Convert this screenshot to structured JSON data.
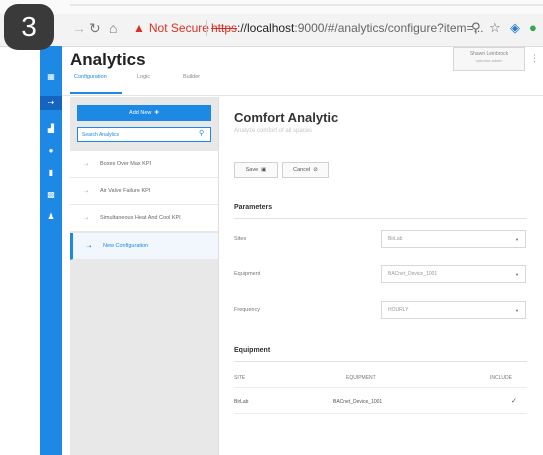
{
  "step": {
    "number": "3"
  },
  "browser": {
    "not_secure_label": "Not Secure",
    "url_scheme": "https",
    "url_host": "://localhost",
    "url_rest": ":9000/#/analytics/configure?item=..."
  },
  "icons": {
    "back": "back-arrow-icon",
    "reload": "reload-icon",
    "home": "home-icon",
    "search": "magnifier-icon",
    "star": "star-icon",
    "extension1": "extension-icon",
    "extension2": "extension-icon"
  },
  "colors": {
    "accent": "#1e88e5",
    "rail": "#1e88e5",
    "warning": "#d93025"
  },
  "app": {
    "title": "Analytics"
  },
  "user": {
    "name": "Shawn Leinbrock",
    "sub": "operator admin"
  },
  "tabs": [
    {
      "label": "Configuration"
    },
    {
      "label": "Logic"
    },
    {
      "label": "Builder"
    }
  ],
  "sidebar": {
    "add_button_label": "Add New",
    "search_placeholder": "Search Analytics",
    "items": [
      {
        "label": "Boxes Over Max KPI"
      },
      {
        "label": "Air Valve Failure KPI"
      },
      {
        "label": "Simultaneous Heat And Cool KPI"
      },
      {
        "label": "New Configuration"
      }
    ]
  },
  "content": {
    "title": "Comfort Analytic",
    "subtitle": "Analyze comfort of all spaces",
    "save_label": "Save",
    "cancel_label": "Cancel",
    "parameters_title": "Parameters",
    "fields": [
      {
        "label": "Sites",
        "value": "BirLab"
      },
      {
        "label": "Equipment",
        "value": "BACnet_Device_1001"
      },
      {
        "label": "Frequency",
        "value": "HOURLY"
      }
    ],
    "equipment_title": "Equipment",
    "table": {
      "columns": [
        "SITE",
        "EQUIPMENT",
        "INCLUDE"
      ],
      "rows": [
        {
          "site": "BirLab",
          "equipment": "BACnet_Device_1001",
          "include": "✓"
        }
      ]
    }
  }
}
